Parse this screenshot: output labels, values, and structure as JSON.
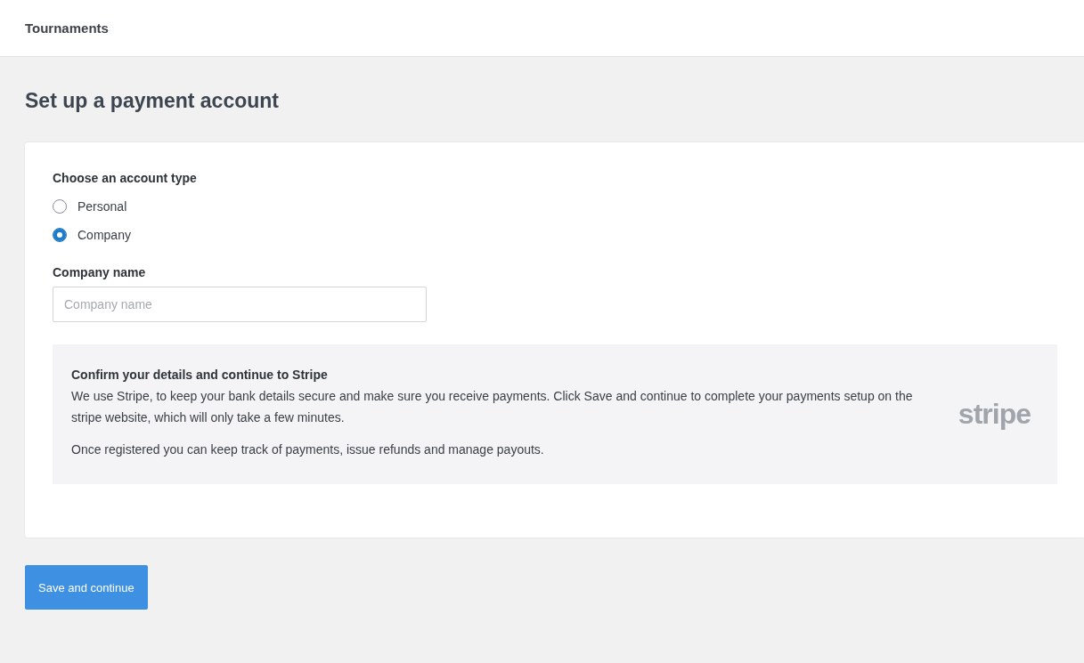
{
  "header": {
    "title": "Tournaments"
  },
  "page_title": "Set up a payment account",
  "account_type": {
    "label": "Choose an account type",
    "options": [
      {
        "label": "Personal",
        "selected": false
      },
      {
        "label": "Company",
        "selected": true
      }
    ]
  },
  "company_name": {
    "label": "Company name",
    "placeholder": "Company name"
  },
  "info": {
    "title": "Confirm your details and continue to Stripe",
    "paragraphs": [
      "We use Stripe, to keep your bank details secure and make sure you receive payments. Click Save and continue to complete your payments setup on the stripe website, which will only take a few minutes.",
      "Once registered you can keep track of payments, issue refunds and manage payouts."
    ],
    "logo": "stripe"
  },
  "button": "Save and continue"
}
